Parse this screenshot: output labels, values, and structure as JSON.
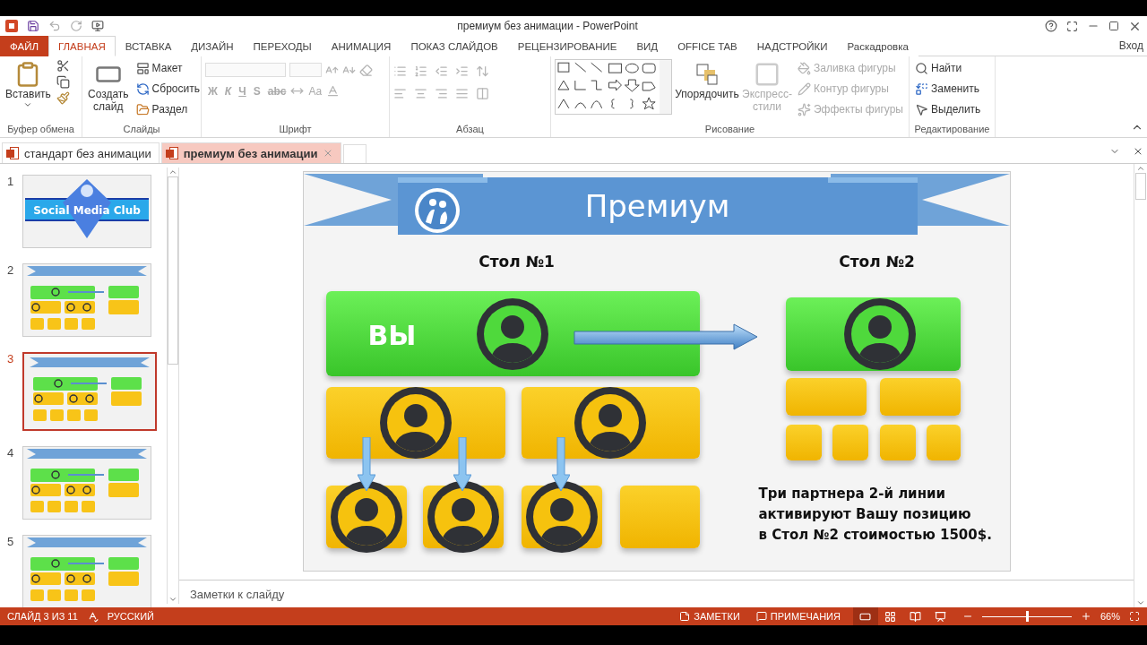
{
  "window": {
    "title": "премиум без анимации - PowerPoint"
  },
  "ribbon_tabs": [
    {
      "label": "ФАЙЛ",
      "kind": "file",
      "selected": false
    },
    {
      "label": "ГЛАВНАЯ",
      "kind": "tab",
      "selected": true
    },
    {
      "label": "ВСТАВКА",
      "kind": "tab",
      "selected": false
    },
    {
      "label": "ДИЗАЙН",
      "kind": "tab",
      "selected": false
    },
    {
      "label": "ПЕРЕХОДЫ",
      "kind": "tab",
      "selected": false
    },
    {
      "label": "АНИМАЦИЯ",
      "kind": "tab",
      "selected": false
    },
    {
      "label": "ПОКАЗ СЛАЙДОВ",
      "kind": "tab",
      "selected": false
    },
    {
      "label": "РЕЦЕНЗИРОВАНИЕ",
      "kind": "tab",
      "selected": false
    },
    {
      "label": "ВИД",
      "kind": "tab",
      "selected": false
    },
    {
      "label": "OFFICE TAB",
      "kind": "tab",
      "selected": false
    },
    {
      "label": "НАДСТРОЙКИ",
      "kind": "tab",
      "selected": false
    },
    {
      "label": "Раскадровка",
      "kind": "tab",
      "selected": false
    }
  ],
  "sign_in": "Вход",
  "ribbon_groups": [
    {
      "kind": "clipboard",
      "label": "Буфер обмена",
      "items": [
        {
          "label": "Вставить"
        }
      ]
    },
    {
      "kind": "slides",
      "label": "Слайды",
      "items": [
        {
          "label": "Создать слайд"
        },
        {
          "label": "Макет"
        },
        {
          "label": "Сбросить"
        },
        {
          "label": "Раздел"
        }
      ]
    },
    {
      "kind": "font",
      "label": "Шрифт",
      "items": [
        {
          "label": "Ж",
          "disabled": true
        },
        {
          "label": "К",
          "disabled": true
        },
        {
          "label": "Ч",
          "disabled": true
        },
        {
          "label": "S",
          "disabled": true
        },
        {
          "label": "abc",
          "disabled": true
        },
        {
          "label": "Aa",
          "disabled": true
        }
      ]
    },
    {
      "kind": "paragraph",
      "label": "Абзац"
    },
    {
      "kind": "drawing",
      "label": "Рисование",
      "items": [
        {
          "label": "Упорядочить",
          "disabled": false
        },
        {
          "label": "Экспресс-стили",
          "disabled": true
        },
        {
          "label": "Заливка фигуры",
          "disabled": true
        },
        {
          "label": "Контур фигуры",
          "disabled": true
        },
        {
          "label": "Эффекты фигуры",
          "disabled": true
        }
      ]
    },
    {
      "kind": "editing",
      "label": "Редактирование",
      "items": [
        {
          "label": "Найти"
        },
        {
          "label": "Заменить"
        },
        {
          "label": "Выделить"
        }
      ]
    }
  ],
  "document_tabs": [
    {
      "label": "стандарт без анимации",
      "selected": false
    },
    {
      "label": "премиум без анимации",
      "selected": true
    }
  ],
  "thumbnails": [
    {
      "number": "1",
      "kind": "title",
      "title": "Social Media Club",
      "selected": false
    },
    {
      "number": "2",
      "kind": "content",
      "selected": false
    },
    {
      "number": "3",
      "kind": "content",
      "selected": true
    },
    {
      "number": "4",
      "kind": "content",
      "selected": false
    },
    {
      "number": "5",
      "kind": "content",
      "selected": false
    }
  ],
  "slide": {
    "title": "Премиум",
    "table_1": "Стол №1",
    "table_2": "Стол №2",
    "you": "ВЫ",
    "note": "Три партнера 2-й линии\nактивируют Вашу позицию\nв Стол №2 стоимостью 1500$."
  },
  "notes_placeholder": "Заметки к слайду",
  "status_bar": {
    "slide": "СЛАЙД 3 ИЗ 11",
    "language": "РУССКИЙ",
    "notes": "ЗАМЕТКИ",
    "comments": "ПРИМЕЧАНИЯ",
    "views": [
      {
        "selected": true
      },
      {
        "selected": false
      },
      {
        "selected": false
      },
      {
        "selected": false
      }
    ],
    "zoom_slider": {
      "level": 0.5
    },
    "zoom": "66%"
  }
}
